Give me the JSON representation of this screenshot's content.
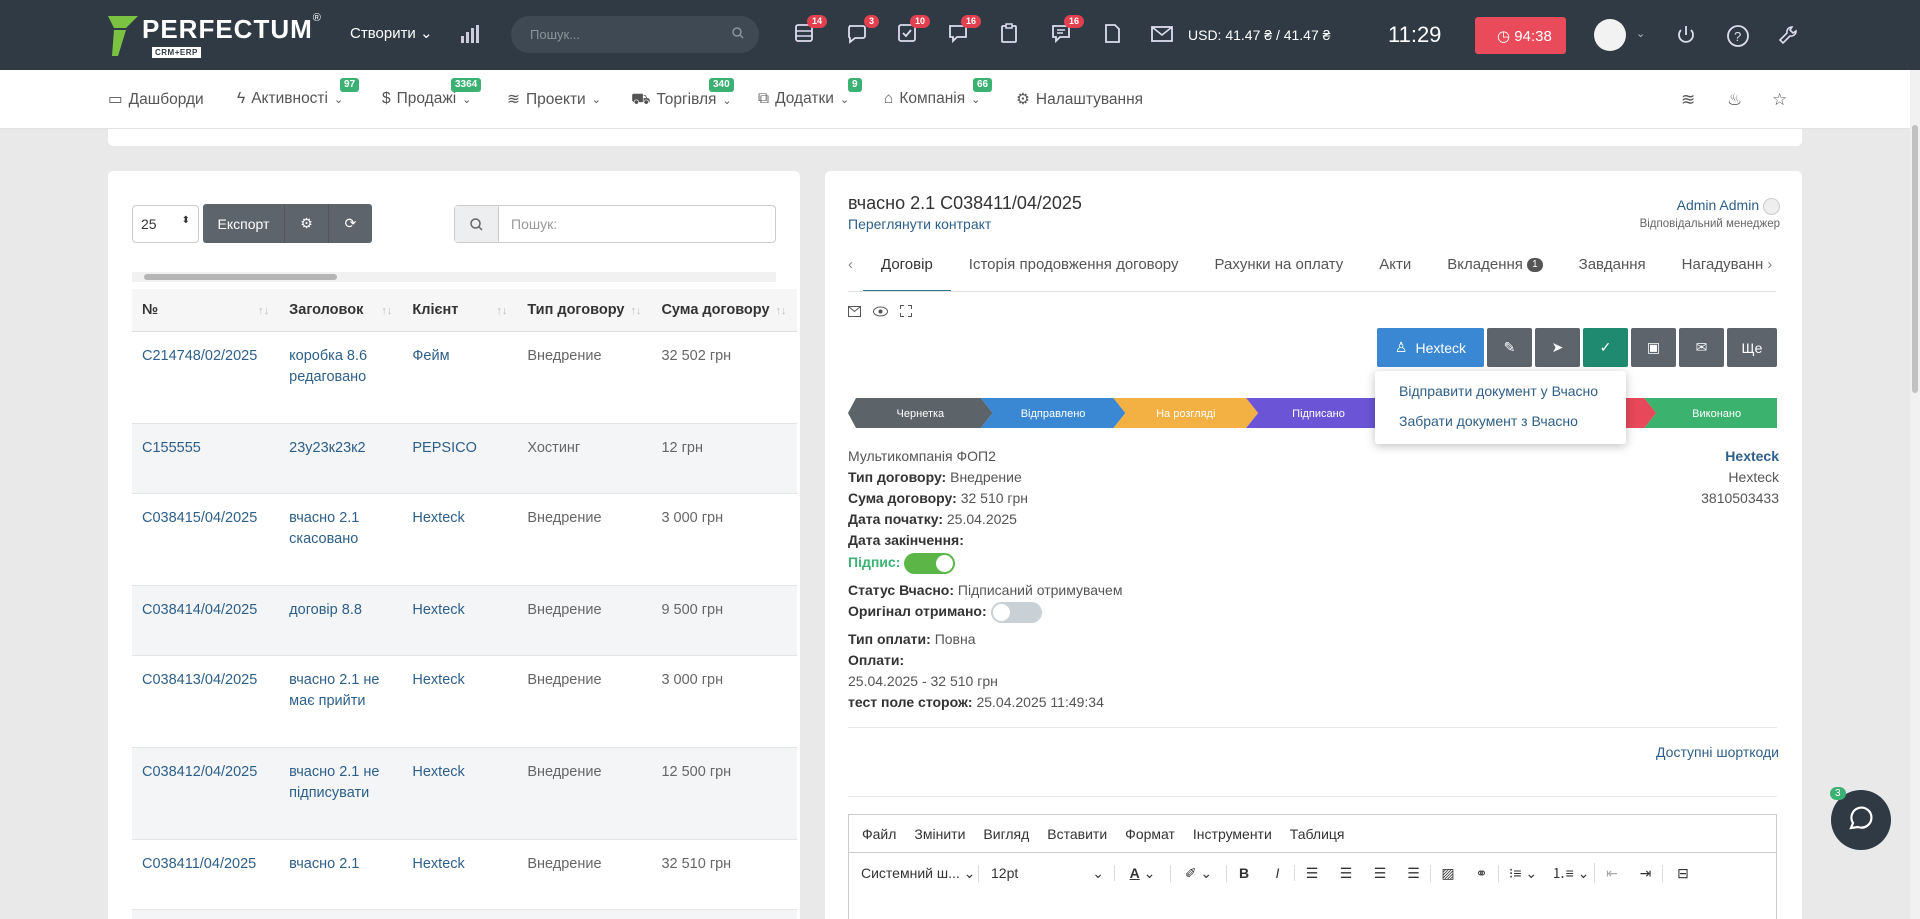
{
  "brand": {
    "name": "PERFECTUM",
    "sub": "CRM+ERP",
    "reg": "®"
  },
  "topbar": {
    "create_label": "Створити",
    "search_placeholder": "Пошук...",
    "currency": "USD: 41.47 ₴ / 41.47 ₴",
    "time": "11:29",
    "timer": "94:38",
    "notifications": [
      {
        "name": "list-icon",
        "count": "14"
      },
      {
        "name": "chat-bubble-icon",
        "count": "3"
      },
      {
        "name": "check-tasks-icon",
        "count": "10"
      },
      {
        "name": "messages-icon",
        "count": "16"
      },
      {
        "name": "clipboard-icon",
        "count": ""
      },
      {
        "name": "comments-icon",
        "count": "16"
      },
      {
        "name": "document-icon",
        "count": ""
      }
    ]
  },
  "menu": {
    "items": [
      {
        "label": "Дашборди",
        "badge": ""
      },
      {
        "label": "Активності",
        "badge": "97"
      },
      {
        "label": "Продажі",
        "badge": "3364"
      },
      {
        "label": "Проекти",
        "badge": ""
      },
      {
        "label": "Торгівля",
        "badge": "340"
      },
      {
        "label": "Додатки",
        "badge": "9"
      },
      {
        "label": "Компанія",
        "badge": "66"
      },
      {
        "label": "Налаштування",
        "badge": ""
      }
    ]
  },
  "left": {
    "page_size": "25",
    "export_label": "Експорт",
    "search_placeholder": "Пошук:",
    "columns": [
      "№",
      "Заголовок",
      "Клієнт",
      "Тип договору",
      "Сума договору"
    ],
    "rows": [
      {
        "num": "C214748/02/2025",
        "title": "коробка 8.6 редаговано",
        "client": "Фейм",
        "type": "Внедрение",
        "sum": "32 502 грн"
      },
      {
        "num": "C155555",
        "title": "23у23к23к2",
        "client": "PEPSICO",
        "type": "Хостинг",
        "sum": "12 грн"
      },
      {
        "num": "C038415/04/2025",
        "title": "вчасно 2.1 скасовано",
        "client": "Hexteck",
        "type": "Внедрение",
        "sum": "3 000 грн"
      },
      {
        "num": "C038414/04/2025",
        "title": "договір 8.8",
        "client": "Hexteck",
        "type": "Внедрение",
        "sum": "9 500 грн"
      },
      {
        "num": "C038413/04/2025",
        "title": "вчасно 2.1 не має прийти",
        "client": "Hexteck",
        "type": "Внедрение",
        "sum": "3 000 грн"
      },
      {
        "num": "C038412/04/2025",
        "title": "вчасно 2.1 не підписувати",
        "client": "Hexteck",
        "type": "Внедрение",
        "sum": "12 500 грн"
      },
      {
        "num": "C038411/04/2025",
        "title": "вчасно 2.1",
        "client": "Hexteck",
        "type": "Внедрение",
        "sum": "32 510 грн"
      }
    ]
  },
  "right": {
    "title": "вчасно 2.1 C038411/04/2025",
    "view_link": "Переглянути контракт",
    "manager": "Admin Admin",
    "manager_role": "Відповідальний менеджер",
    "tabs": [
      {
        "label": "Договір",
        "badge": ""
      },
      {
        "label": "Історія продовження договору",
        "badge": ""
      },
      {
        "label": "Рахунки на оплату",
        "badge": ""
      },
      {
        "label": "Акти",
        "badge": ""
      },
      {
        "label": "Вкладення",
        "badge": "1"
      },
      {
        "label": "Завдання",
        "badge": ""
      },
      {
        "label": "Нагадуванн",
        "badge": ""
      }
    ],
    "client_button": "Hexteck",
    "more_button": "Ще",
    "dropdown": [
      "Відправити документ у Вчасно",
      "Забрати документ з Вчасно"
    ],
    "pipeline": [
      {
        "label": "Чернетка",
        "color": "#5c6369"
      },
      {
        "label": "Відправлено",
        "color": "#3a87d4"
      },
      {
        "label": "На розгляді",
        "color": "#f3b043"
      },
      {
        "label": "Підписано",
        "color": "#6b55d6"
      },
      {
        "label": "",
        "color": "#3a4550"
      },
      {
        "label": "",
        "color": "#e8495a"
      },
      {
        "label": "Виконано",
        "color": "#3bb26d"
      }
    ],
    "company": "Мультикомпанія ФОП2",
    "type_label": "Тип договору:",
    "type_value": "Внедрение",
    "sum_label": "Сума договору:",
    "sum_value": "32 510 грн",
    "start_label": "Дата початку:",
    "start_value": "25.04.2025",
    "end_label": "Дата закінчення:",
    "sign_label": "Підпис:",
    "signed": true,
    "status_label": "Статус Вчасно:",
    "status_value": "Підписаний отримувачем",
    "original_label": "Оригінал отримано:",
    "original": false,
    "paytype_label": "Тип оплати:",
    "paytype_value": "Повна",
    "payments_label": "Оплати:",
    "payment_line": "25.04.2025 - 32 510 грн",
    "guard_label": "тест поле сторож:",
    "guard_value": "25.04.2025 11:49:34",
    "client_name": "Hexteck",
    "client_sub": "Hexteck",
    "client_code": "3810503433",
    "shortcodes": "Доступні шорткоди",
    "editor": {
      "menu": [
        "Файл",
        "Змінити",
        "Вигляд",
        "Вставити",
        "Формат",
        "Інструменти",
        "Таблиця"
      ],
      "font": "Системний ш...",
      "size": "12pt"
    }
  },
  "chat": {
    "count": "3"
  }
}
